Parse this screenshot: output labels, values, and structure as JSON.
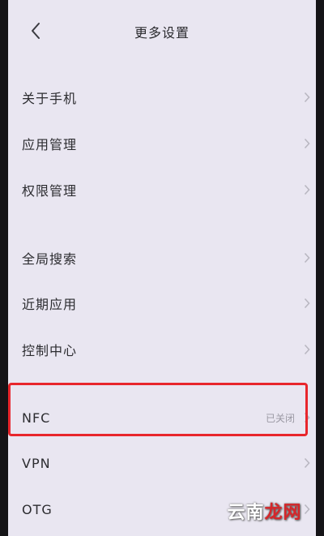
{
  "header": {
    "title": "更多设置"
  },
  "menu": [
    {
      "label": "关于手机"
    },
    {
      "label": "应用管理"
    },
    {
      "label": "权限管理"
    },
    {
      "label": "全局搜索"
    },
    {
      "label": "近期应用"
    },
    {
      "label": "控制中心"
    },
    {
      "label": "NFC",
      "value": "已关闭"
    },
    {
      "label": "VPN"
    },
    {
      "label": "OTG"
    }
  ],
  "watermark": {
    "text_a": "云南",
    "text_b": "龙网"
  },
  "colors": {
    "screen_bg": "#e9e6f1",
    "text": "#2c2c30",
    "secondary_text": "#9a98a3",
    "highlight_border": "#e8262c"
  },
  "icons": {
    "back": "chevron-left-icon",
    "row_arrow": "chevron-right-icon"
  }
}
